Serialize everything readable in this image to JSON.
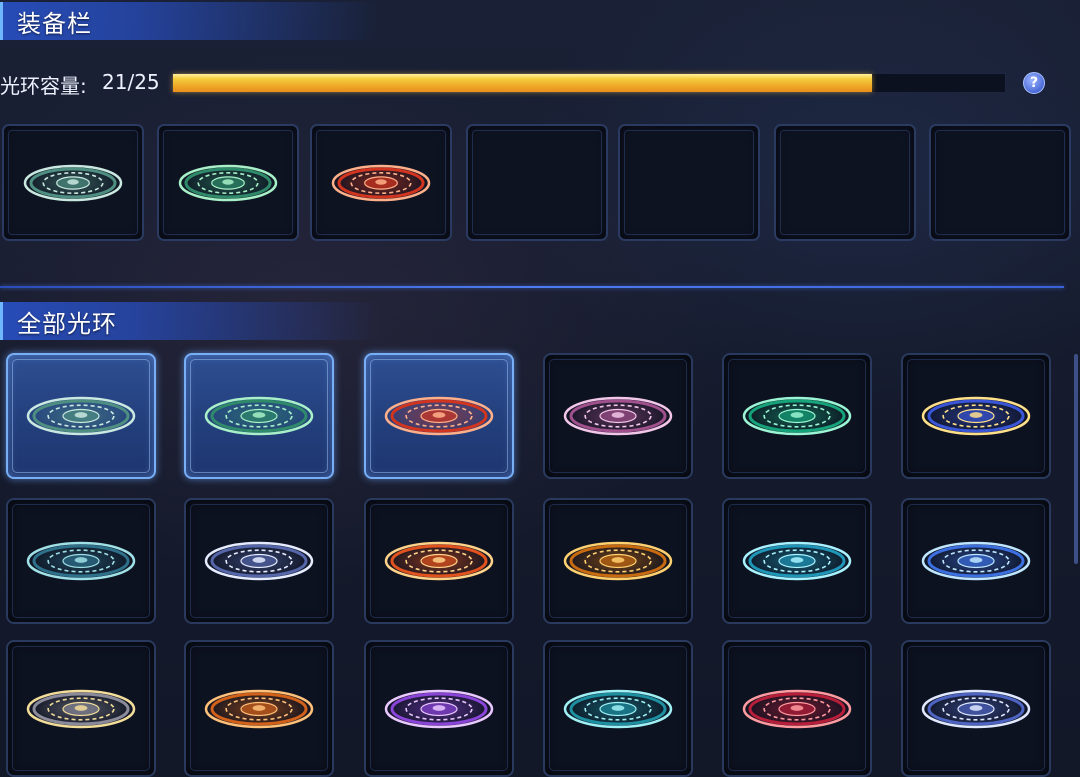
{
  "equip_bar": {
    "title": "装备栏",
    "capacity_label": "光环容量:",
    "capacity_value": "21/25",
    "capacity_fraction": 0.84,
    "help_icon": "question-mark-icon",
    "slots": [
      {
        "filled": true,
        "aura": "silver-teal-ring",
        "colors": [
          "#c9e8e0",
          "#4f8f82"
        ]
      },
      {
        "filled": true,
        "aura": "jade-cloud-ring",
        "colors": [
          "#a8f0c8",
          "#2f8a6a"
        ]
      },
      {
        "filled": true,
        "aura": "crimson-flame-ring",
        "colors": [
          "#ffb08a",
          "#d2351f"
        ]
      },
      {
        "filled": false
      },
      {
        "filled": false
      },
      {
        "filled": false
      },
      {
        "filled": false
      }
    ]
  },
  "all_auras": {
    "title": "全部光环",
    "items": [
      {
        "aura": "silver-teal-ring",
        "selected": true,
        "colors": [
          "#c9e8e0",
          "#4f8f82"
        ]
      },
      {
        "aura": "jade-cloud-ring",
        "selected": true,
        "colors": [
          "#a8f0c8",
          "#2f8a6a"
        ]
      },
      {
        "aura": "crimson-flame-ring",
        "selected": true,
        "colors": [
          "#ffb08a",
          "#d2351f"
        ]
      },
      {
        "aura": "pink-rune-ring",
        "selected": false,
        "colors": [
          "#f2c6e8",
          "#a0508c"
        ]
      },
      {
        "aura": "emerald-rune-ring",
        "selected": false,
        "colors": [
          "#9af5d4",
          "#16a37a"
        ]
      },
      {
        "aura": "gold-sapphire-ring",
        "selected": false,
        "colors": [
          "#ffe08a",
          "#3a56d6"
        ]
      },
      {
        "aura": "teal-crest-ring",
        "selected": false,
        "colors": [
          "#9fe0e6",
          "#2e6f8a"
        ]
      },
      {
        "aura": "yin-yang-ring",
        "selected": false,
        "colors": [
          "#e6ecff",
          "#5566aa"
        ]
      },
      {
        "aura": "orange-phoenix-ring",
        "selected": false,
        "colors": [
          "#ffd28a",
          "#e0521e"
        ]
      },
      {
        "aura": "amber-gear-ring",
        "selected": false,
        "colors": [
          "#ffd070",
          "#c86a10"
        ]
      },
      {
        "aura": "cyan-sigil-ring",
        "selected": false,
        "colors": [
          "#a8f2ff",
          "#1f95b8"
        ]
      },
      {
        "aura": "azure-dragon-ring",
        "selected": false,
        "colors": [
          "#bfe6ff",
          "#3c6fe0"
        ]
      },
      {
        "aura": "gold-silver-crest-ring",
        "selected": false,
        "colors": [
          "#f2dc9a",
          "#8a8a9a"
        ]
      },
      {
        "aura": "orange-ember-ring",
        "selected": false,
        "colors": [
          "#ffc07a",
          "#d0601a"
        ]
      },
      {
        "aura": "violet-star-ring",
        "selected": false,
        "colors": [
          "#e8c8ff",
          "#8a44d8"
        ]
      },
      {
        "aura": "aqua-wave-ring",
        "selected": false,
        "colors": [
          "#9ff0f5",
          "#1d8fa0"
        ]
      },
      {
        "aura": "scarlet-lotus-ring",
        "selected": false,
        "colors": [
          "#ff9aa0",
          "#b81e3a"
        ]
      },
      {
        "aura": "silver-blue-ring",
        "selected": false,
        "colors": [
          "#dfe8ff",
          "#4e64c2"
        ]
      }
    ]
  }
}
